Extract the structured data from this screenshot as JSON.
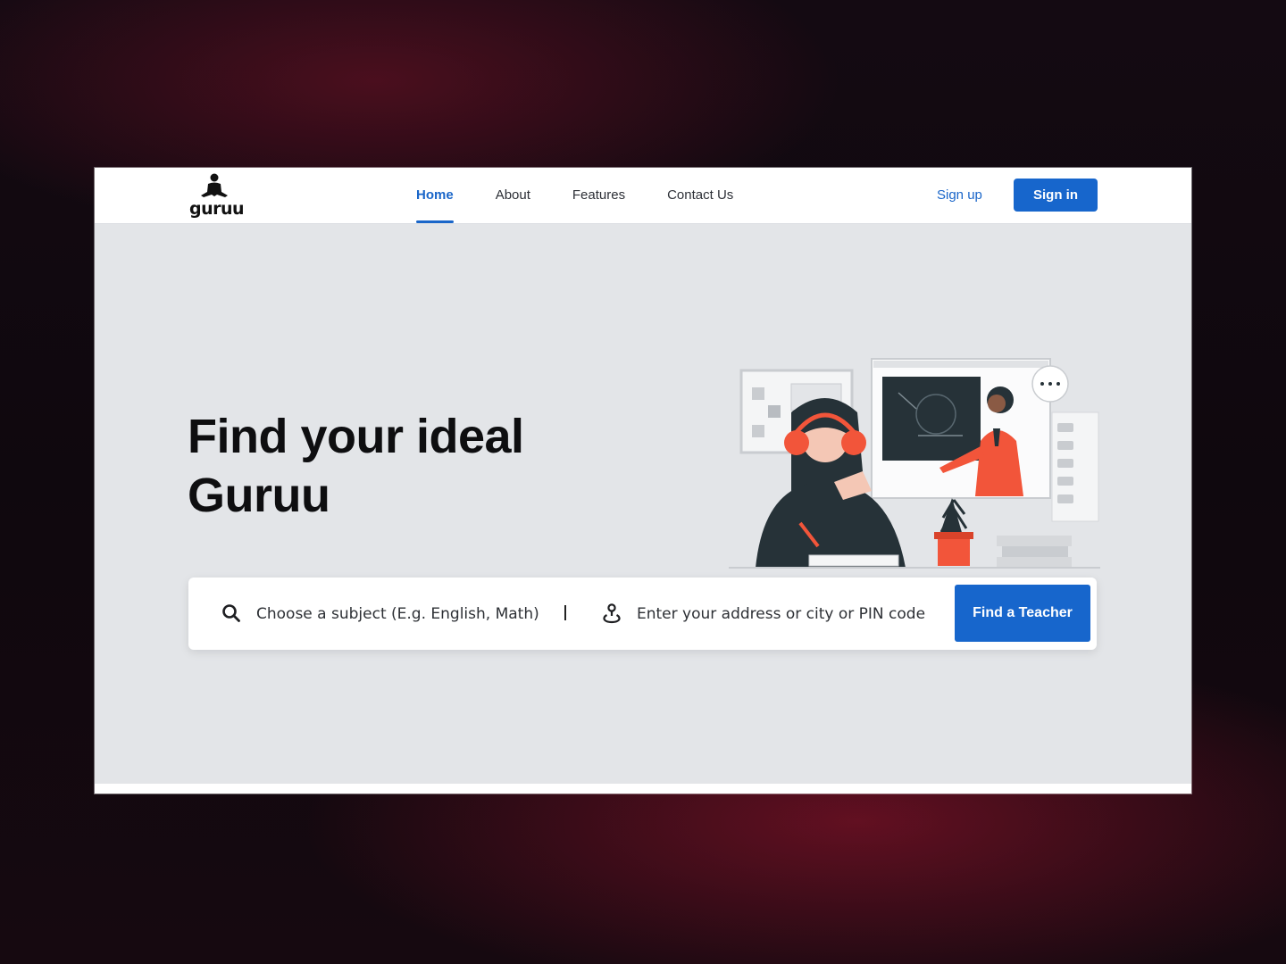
{
  "brand": {
    "logo_text": "guruu"
  },
  "nav": {
    "items": [
      {
        "label": "Home",
        "active": true
      },
      {
        "label": "About",
        "active": false
      },
      {
        "label": "Features",
        "active": false
      },
      {
        "label": "Contact Us",
        "active": false
      }
    ],
    "signup_label": "Sign up",
    "signin_label": "Sign in"
  },
  "hero": {
    "title_line1": "Find your ideal",
    "title_line2": "Guruu"
  },
  "search": {
    "subject_placeholder": "Choose a subject (E.g. English, Math)",
    "subject_icon": "search-icon",
    "address_placeholder": "Enter your address or city or PIN code",
    "address_icon": "location-icon",
    "submit_label": "Find a Teacher"
  },
  "colors": {
    "accent": "#1766cc",
    "hero_bg": "#e3e5e8",
    "illustration_accent": "#f2553a",
    "illustration_dark": "#263238"
  }
}
